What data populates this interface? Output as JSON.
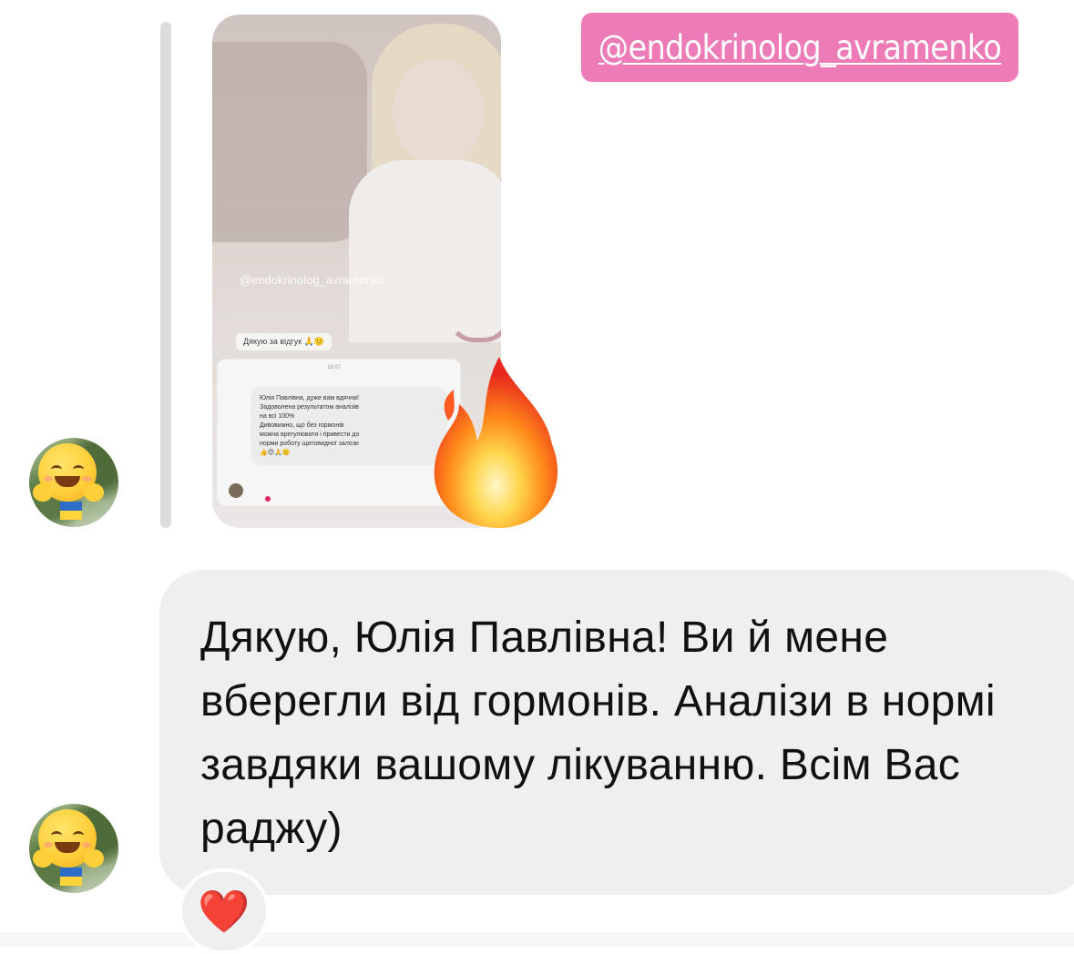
{
  "story_tag": {
    "handle": "@endokrinolog_avramenko"
  },
  "story_thumbnail": {
    "handle": "@endokrinolog_avramenko",
    "thanks_text": "Дякую за відгук 🙏🙂",
    "chat_time": "18:07",
    "chat_text": "Юлія Павлівна, дуже вам вдячна!\nЗадоволена результатом аналізів\nна всі 100%\nДивовижно, що без гормонів\nможна врегулювати і привести до\nнорми роботу щитовидної залози\n👍😊🙏🙂"
  },
  "message": {
    "text": "Дякую, Юлія Павлівна! Ви й мене вберегли від гормонів. Аналізи в нормі завдяки вашому лікуванню. Всім Вас раджу)"
  },
  "reaction": {
    "emoji": "❤️"
  },
  "colors": {
    "tag_background": "#ed7bb8",
    "bubble_background": "#efefef",
    "reply_line": "#dcdcdc",
    "heart": "#e8263a"
  },
  "icons": [
    "fire-icon",
    "heart-icon",
    "hugging-face-emoji",
    "ukraine-flag-icon"
  ]
}
